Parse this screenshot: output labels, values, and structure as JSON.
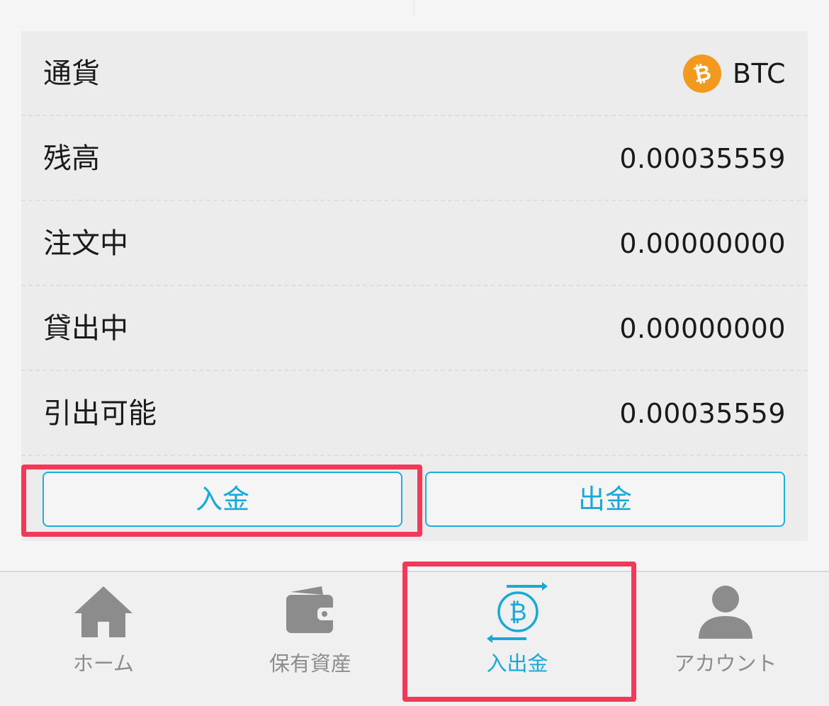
{
  "colors": {
    "accent": "#1aa8d6",
    "highlight": "#f2395a",
    "bitcoin": "#f39a1e",
    "inactive_tab": "#8c8c8c"
  },
  "balance": {
    "rows": [
      {
        "label": "通貨",
        "value": "BTC",
        "icon": "bitcoin-icon"
      },
      {
        "label": "残高",
        "value": "0.00035559"
      },
      {
        "label": "注文中",
        "value": "0.00000000"
      },
      {
        "label": "貸出中",
        "value": "0.00000000"
      },
      {
        "label": "引出可能",
        "value": "0.00035559"
      }
    ],
    "btc_symbol": "₿"
  },
  "actions": {
    "deposit_label": "入金",
    "withdraw_label": "出金"
  },
  "tabbar": {
    "items": [
      {
        "label": "ホーム",
        "icon": "home-icon",
        "active": false
      },
      {
        "label": "保有資産",
        "icon": "wallet-icon",
        "active": false
      },
      {
        "label": "入出金",
        "icon": "bitcoin-transfer-icon",
        "active": true
      },
      {
        "label": "アカウント",
        "icon": "person-icon",
        "active": false
      }
    ]
  }
}
